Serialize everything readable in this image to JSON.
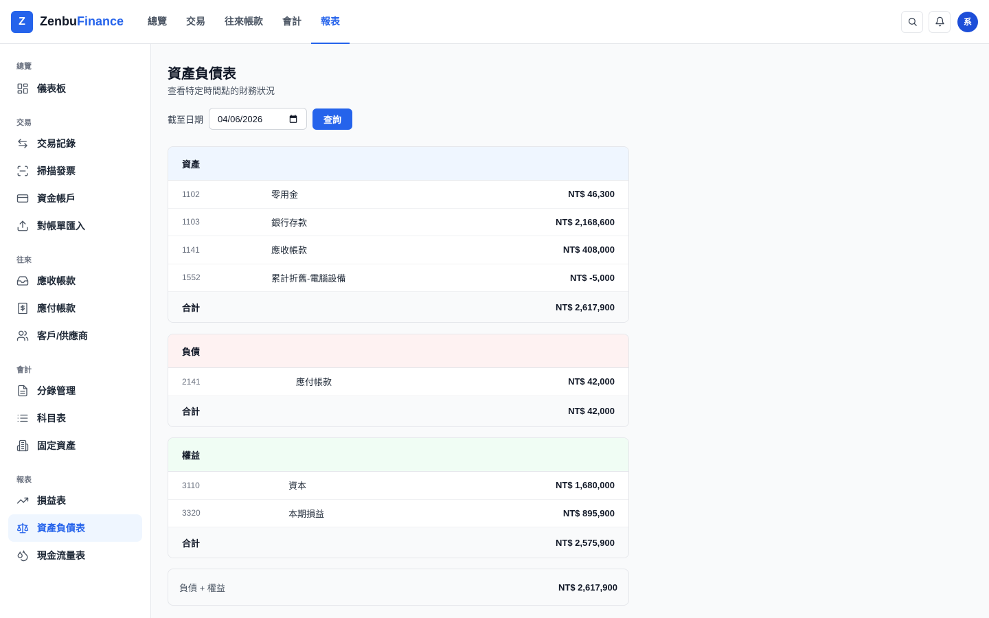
{
  "brand": {
    "logo": "Z",
    "name_part1": "Zenbu",
    "name_part2": "Finance"
  },
  "topnav": {
    "items": [
      {
        "label": "總覽"
      },
      {
        "label": "交易"
      },
      {
        "label": "往來帳款"
      },
      {
        "label": "會計"
      },
      {
        "label": "報表"
      }
    ],
    "active": "報表"
  },
  "top_actions": {
    "search_icon": "search-icon",
    "bell_icon": "bell-icon",
    "avatar": "系"
  },
  "sidebar": {
    "groups": [
      {
        "title": "總覽",
        "items": [
          {
            "label": "儀表板",
            "icon": "dashboard-icon"
          }
        ]
      },
      {
        "title": "交易",
        "items": [
          {
            "label": "交易記錄",
            "icon": "transfer-icon"
          },
          {
            "label": "掃描發票",
            "icon": "scan-icon"
          },
          {
            "label": "資金帳戶",
            "icon": "card-icon"
          },
          {
            "label": "對帳單匯入",
            "icon": "upload-icon"
          }
        ]
      },
      {
        "title": "往來",
        "items": [
          {
            "label": "應收帳款",
            "icon": "inbox-icon"
          },
          {
            "label": "應付帳款",
            "icon": "receipt-icon"
          },
          {
            "label": "客戶/供應商",
            "icon": "users-icon"
          }
        ]
      },
      {
        "title": "會計",
        "items": [
          {
            "label": "分錄管理",
            "icon": "document-icon"
          },
          {
            "label": "科目表",
            "icon": "list-icon"
          },
          {
            "label": "固定資產",
            "icon": "building-icon"
          }
        ]
      },
      {
        "title": "報表",
        "items": [
          {
            "label": "損益表",
            "icon": "trend-icon"
          },
          {
            "label": "資產負債表",
            "icon": "scale-icon",
            "active": true
          },
          {
            "label": "現金流量表",
            "icon": "drops-icon"
          }
        ]
      }
    ]
  },
  "page": {
    "title": "資產負債表",
    "subtitle": "查看特定時間點的財務狀況",
    "filter_label": "截至日期",
    "date_value": "04/06/2026",
    "query_button": "查詢"
  },
  "sections": {
    "assets": {
      "title": "資產",
      "color": "#eff6ff",
      "rows": [
        {
          "code": "1102",
          "name": "零用金",
          "amount": "NT$ 46,300"
        },
        {
          "code": "1103",
          "name": "銀行存款",
          "amount": "NT$ 2,168,600"
        },
        {
          "code": "1141",
          "name": "應收帳款",
          "amount": "NT$ 408,000"
        },
        {
          "code": "1552",
          "name": "累計折舊-電腦設備",
          "amount": "NT$ -5,000"
        }
      ],
      "total_label": "合計",
      "total": "NT$ 2,617,900"
    },
    "liabilities": {
      "title": "負債",
      "color": "#fef2f2",
      "rows": [
        {
          "code": "2141",
          "name": "應付帳款",
          "amount": "NT$ 42,000"
        }
      ],
      "total_label": "合計",
      "total": "NT$ 42,000"
    },
    "equity": {
      "title": "權益",
      "color": "#f0fdf4",
      "rows": [
        {
          "code": "3110",
          "name": "資本",
          "amount": "NT$ 1,680,000"
        },
        {
          "code": "3320",
          "name": "本期損益",
          "amount": "NT$ 895,900"
        }
      ],
      "total_label": "合計",
      "total": "NT$ 2,575,900"
    }
  },
  "summary": {
    "label": "負債 + 權益",
    "amount": "NT$ 2,617,900"
  },
  "colors": {
    "accent": "#2563eb"
  }
}
